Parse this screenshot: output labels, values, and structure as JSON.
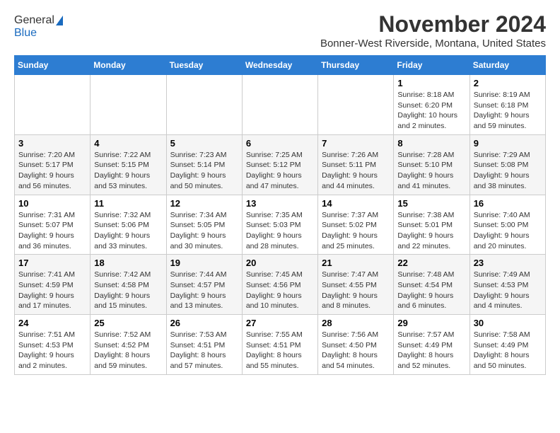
{
  "logo": {
    "general": "General",
    "blue": "Blue"
  },
  "title": "November 2024",
  "subtitle": "Bonner-West Riverside, Montana, United States",
  "days_of_week": [
    "Sunday",
    "Monday",
    "Tuesday",
    "Wednesday",
    "Thursday",
    "Friday",
    "Saturday"
  ],
  "weeks": [
    [
      {
        "day": "",
        "info": ""
      },
      {
        "day": "",
        "info": ""
      },
      {
        "day": "",
        "info": ""
      },
      {
        "day": "",
        "info": ""
      },
      {
        "day": "",
        "info": ""
      },
      {
        "day": "1",
        "info": "Sunrise: 8:18 AM\nSunset: 6:20 PM\nDaylight: 10 hours and 2 minutes."
      },
      {
        "day": "2",
        "info": "Sunrise: 8:19 AM\nSunset: 6:18 PM\nDaylight: 9 hours and 59 minutes."
      }
    ],
    [
      {
        "day": "3",
        "info": "Sunrise: 7:20 AM\nSunset: 5:17 PM\nDaylight: 9 hours and 56 minutes."
      },
      {
        "day": "4",
        "info": "Sunrise: 7:22 AM\nSunset: 5:15 PM\nDaylight: 9 hours and 53 minutes."
      },
      {
        "day": "5",
        "info": "Sunrise: 7:23 AM\nSunset: 5:14 PM\nDaylight: 9 hours and 50 minutes."
      },
      {
        "day": "6",
        "info": "Sunrise: 7:25 AM\nSunset: 5:12 PM\nDaylight: 9 hours and 47 minutes."
      },
      {
        "day": "7",
        "info": "Sunrise: 7:26 AM\nSunset: 5:11 PM\nDaylight: 9 hours and 44 minutes."
      },
      {
        "day": "8",
        "info": "Sunrise: 7:28 AM\nSunset: 5:10 PM\nDaylight: 9 hours and 41 minutes."
      },
      {
        "day": "9",
        "info": "Sunrise: 7:29 AM\nSunset: 5:08 PM\nDaylight: 9 hours and 38 minutes."
      }
    ],
    [
      {
        "day": "10",
        "info": "Sunrise: 7:31 AM\nSunset: 5:07 PM\nDaylight: 9 hours and 36 minutes."
      },
      {
        "day": "11",
        "info": "Sunrise: 7:32 AM\nSunset: 5:06 PM\nDaylight: 9 hours and 33 minutes."
      },
      {
        "day": "12",
        "info": "Sunrise: 7:34 AM\nSunset: 5:05 PM\nDaylight: 9 hours and 30 minutes."
      },
      {
        "day": "13",
        "info": "Sunrise: 7:35 AM\nSunset: 5:03 PM\nDaylight: 9 hours and 28 minutes."
      },
      {
        "day": "14",
        "info": "Sunrise: 7:37 AM\nSunset: 5:02 PM\nDaylight: 9 hours and 25 minutes."
      },
      {
        "day": "15",
        "info": "Sunrise: 7:38 AM\nSunset: 5:01 PM\nDaylight: 9 hours and 22 minutes."
      },
      {
        "day": "16",
        "info": "Sunrise: 7:40 AM\nSunset: 5:00 PM\nDaylight: 9 hours and 20 minutes."
      }
    ],
    [
      {
        "day": "17",
        "info": "Sunrise: 7:41 AM\nSunset: 4:59 PM\nDaylight: 9 hours and 17 minutes."
      },
      {
        "day": "18",
        "info": "Sunrise: 7:42 AM\nSunset: 4:58 PM\nDaylight: 9 hours and 15 minutes."
      },
      {
        "day": "19",
        "info": "Sunrise: 7:44 AM\nSunset: 4:57 PM\nDaylight: 9 hours and 13 minutes."
      },
      {
        "day": "20",
        "info": "Sunrise: 7:45 AM\nSunset: 4:56 PM\nDaylight: 9 hours and 10 minutes."
      },
      {
        "day": "21",
        "info": "Sunrise: 7:47 AM\nSunset: 4:55 PM\nDaylight: 9 hours and 8 minutes."
      },
      {
        "day": "22",
        "info": "Sunrise: 7:48 AM\nSunset: 4:54 PM\nDaylight: 9 hours and 6 minutes."
      },
      {
        "day": "23",
        "info": "Sunrise: 7:49 AM\nSunset: 4:53 PM\nDaylight: 9 hours and 4 minutes."
      }
    ],
    [
      {
        "day": "24",
        "info": "Sunrise: 7:51 AM\nSunset: 4:53 PM\nDaylight: 9 hours and 2 minutes."
      },
      {
        "day": "25",
        "info": "Sunrise: 7:52 AM\nSunset: 4:52 PM\nDaylight: 8 hours and 59 minutes."
      },
      {
        "day": "26",
        "info": "Sunrise: 7:53 AM\nSunset: 4:51 PM\nDaylight: 8 hours and 57 minutes."
      },
      {
        "day": "27",
        "info": "Sunrise: 7:55 AM\nSunset: 4:51 PM\nDaylight: 8 hours and 55 minutes."
      },
      {
        "day": "28",
        "info": "Sunrise: 7:56 AM\nSunset: 4:50 PM\nDaylight: 8 hours and 54 minutes."
      },
      {
        "day": "29",
        "info": "Sunrise: 7:57 AM\nSunset: 4:49 PM\nDaylight: 8 hours and 52 minutes."
      },
      {
        "day": "30",
        "info": "Sunrise: 7:58 AM\nSunset: 4:49 PM\nDaylight: 8 hours and 50 minutes."
      }
    ]
  ],
  "colors": {
    "header_bg": "#2d7dd2",
    "header_text": "#ffffff"
  }
}
